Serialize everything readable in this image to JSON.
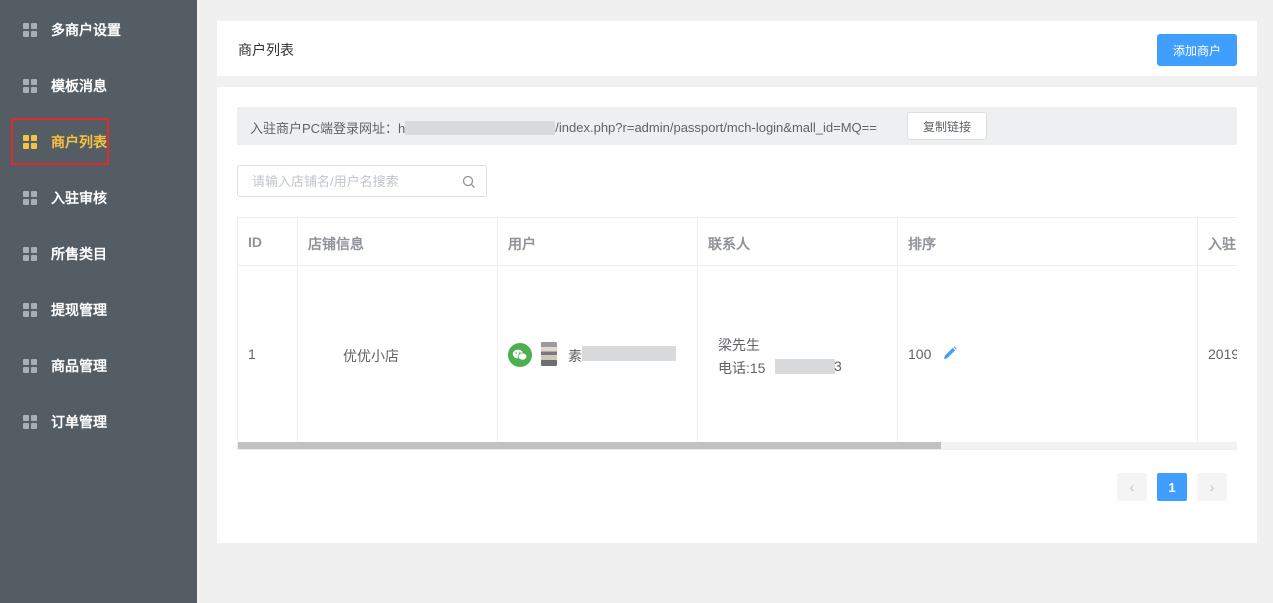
{
  "sidebar": {
    "items": [
      {
        "label": "多商户设置",
        "active": false
      },
      {
        "label": "模板消息",
        "active": false
      },
      {
        "label": "商户列表",
        "active": true
      },
      {
        "label": "入驻审核",
        "active": false
      },
      {
        "label": "所售类目",
        "active": false
      },
      {
        "label": "提现管理",
        "active": false
      },
      {
        "label": "商品管理",
        "active": false
      },
      {
        "label": "订单管理",
        "active": false
      }
    ],
    "active_color": "#f5c242"
  },
  "header": {
    "title": "商户列表",
    "add_button": "添加商户"
  },
  "url_bar": {
    "prefix": "入驻商户PC端登录网址：h",
    "suffix": "/index.php?r=admin/passport/mch-login&mall_id=MQ==",
    "copy_button": "复制链接"
  },
  "search": {
    "placeholder": "请输入店铺名/用户名搜索",
    "value": ""
  },
  "table": {
    "columns": [
      "ID",
      "店铺信息",
      "用户",
      "联系人",
      "排序",
      "入驻"
    ],
    "rows": [
      {
        "id": "1",
        "store": "优优小店",
        "user_name_prefix": "素",
        "contact_name": "梁先生",
        "contact_phone_prefix": "电话:15",
        "contact_phone_suffix": "3",
        "sort": "100",
        "joined_prefix": "2019"
      }
    ],
    "scroll_fraction": 0.703
  },
  "pagination": {
    "prev": "‹",
    "current": "1",
    "next": "›"
  },
  "colors": {
    "sidebar_bg": "#545c64",
    "primary": "#409eff",
    "active_outline": "#e02b2b"
  }
}
